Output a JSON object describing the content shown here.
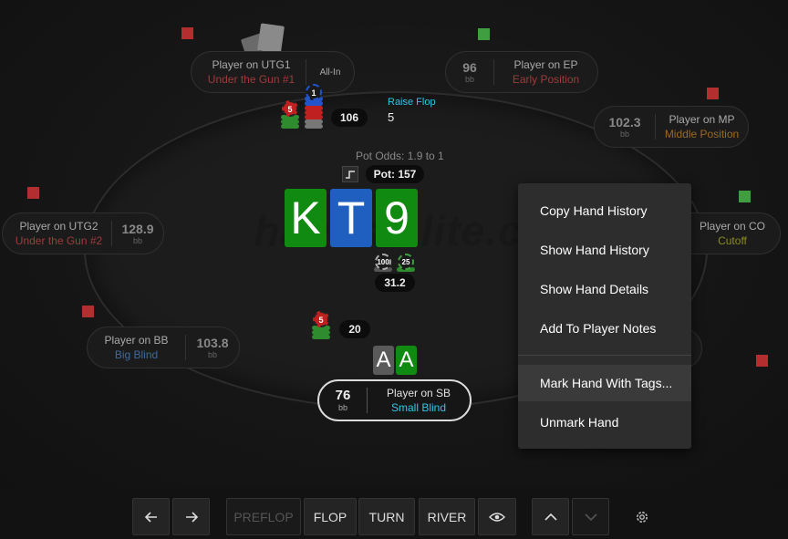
{
  "seats": {
    "utg1": {
      "name": "Player on UTG1",
      "position": "Under the Gun #1",
      "status": "All-In"
    },
    "ep": {
      "name": "Player on EP",
      "position": "Early Position",
      "stack": "96",
      "unit": "bb"
    },
    "mp": {
      "name": "Player on MP",
      "position": "Middle Position",
      "stack": "102.3",
      "unit": "bb"
    },
    "utg2": {
      "name": "Player on UTG2",
      "position": "Under the Gun #2",
      "stack": "128.9",
      "unit": "bb"
    },
    "co": {
      "name": "Player on CO",
      "position": "Cutoff"
    },
    "bb": {
      "name": "Player on BB",
      "position": "Big Blind",
      "stack": "103.8",
      "unit": "bb"
    },
    "sb": {
      "name": "Player on SB",
      "position": "Small Blind",
      "stack": "76",
      "unit": "bb"
    }
  },
  "action": {
    "label": "Raise Flop",
    "amount": "5"
  },
  "bets": {
    "utg1": "106",
    "bb": "20",
    "center": "31.2"
  },
  "chips": {
    "utg1_top_a": "1",
    "utg1_top_b": "5",
    "center_a": "100",
    "center_b": "25",
    "bb": "5"
  },
  "pot": {
    "odds": "Pot Odds: 1.9 to 1",
    "label": "Pot: 157"
  },
  "board": [
    "K",
    "T",
    "9"
  ],
  "hole_cards": [
    "A",
    "A"
  ],
  "watermark": "handstalite.co",
  "context_menu": {
    "items": [
      "Copy Hand History",
      "Show Hand History",
      "Show Hand Details",
      "Add To Player Notes",
      "Mark Hand With Tags...",
      "Unmark Hand"
    ]
  },
  "controls": {
    "prev_icon": "arrow-left-icon",
    "next_icon": "arrow-right-icon",
    "streets": [
      "PREFLOP",
      "FLOP",
      "TURN",
      "RIVER"
    ],
    "eye_icon": "eye-icon",
    "up_icon": "chevron-up-icon",
    "down_icon": "chevron-down-icon",
    "settings_icon": "gear-icon"
  },
  "colors": {
    "card_green": "#118a11",
    "card_blue": "#1f5fbf",
    "card_gray": "#5a5a5a",
    "highlight_cyan": "#2fc6e6",
    "dot_red": "#b32f2f",
    "dot_green": "#3f9e3f"
  }
}
